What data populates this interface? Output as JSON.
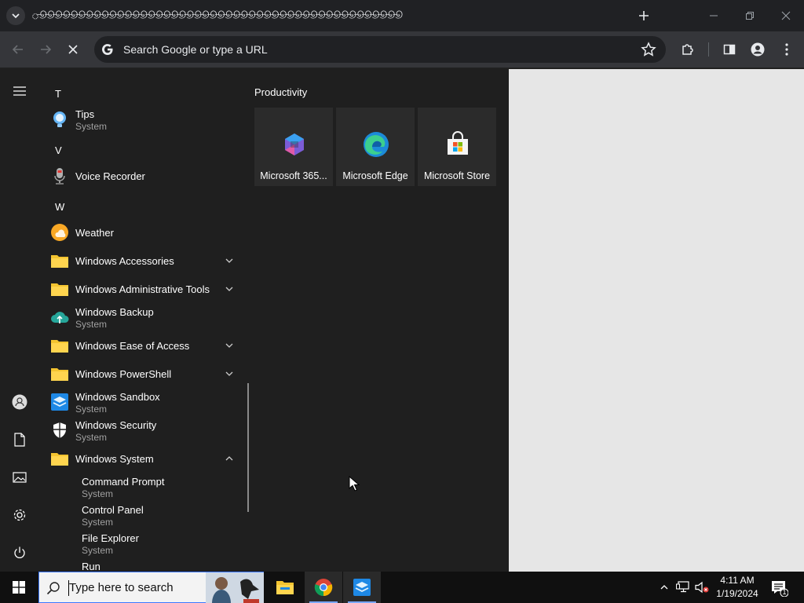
{
  "browser": {
    "tab_title": "ூூூூூூூூூூூூூூூூூூூூூூூூூூூூூூூூூூூூூூூூூூூூூூூ",
    "omnibox_placeholder": "Search Google or type a URL"
  },
  "start_menu": {
    "letters": [
      "T",
      "V",
      "W"
    ],
    "apps": [
      {
        "name": "Tips",
        "sub": "System"
      },
      {
        "name": "Voice Recorder",
        "sub": ""
      },
      {
        "name": "Weather",
        "sub": ""
      },
      {
        "name": "Windows Accessories",
        "sub": ""
      },
      {
        "name": "Windows Administrative Tools",
        "sub": ""
      },
      {
        "name": "Windows Backup",
        "sub": "System"
      },
      {
        "name": "Windows Ease of Access",
        "sub": ""
      },
      {
        "name": "Windows PowerShell",
        "sub": ""
      },
      {
        "name": "Windows Sandbox",
        "sub": "System"
      },
      {
        "name": "Windows Security",
        "sub": "System"
      },
      {
        "name": "Windows System",
        "sub": ""
      },
      {
        "name": "Command Prompt",
        "sub": "System"
      },
      {
        "name": "Control Panel",
        "sub": "System"
      },
      {
        "name": "File Explorer",
        "sub": "System"
      },
      {
        "name": "Run",
        "sub": ""
      }
    ],
    "tiles_group": "Productivity",
    "tiles": [
      {
        "name": "Microsoft 365..."
      },
      {
        "name": "Microsoft Edge"
      },
      {
        "name": "Microsoft Store"
      }
    ]
  },
  "taskbar": {
    "search_placeholder": "Type here to search",
    "time": "4:11 AM",
    "date": "1/19/2024",
    "notification_count": "1"
  },
  "colors": {
    "accent": "#3b78ff",
    "folder": "#f4c430"
  }
}
